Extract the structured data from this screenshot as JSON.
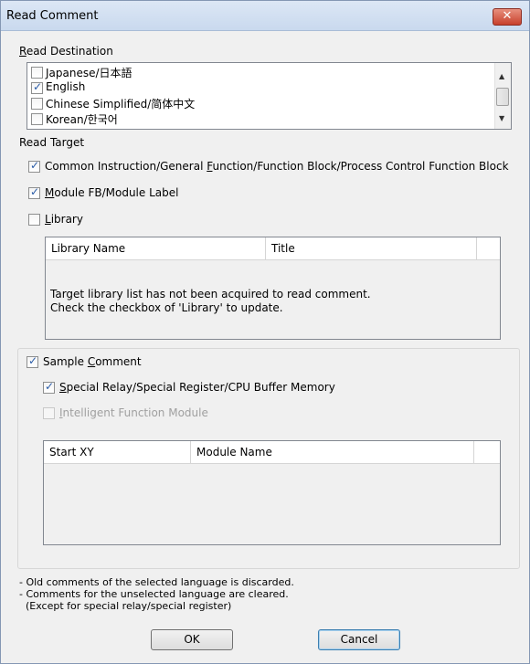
{
  "window": {
    "title": "Read Comment",
    "close_label": "✕"
  },
  "read_destination": {
    "label_u": "R",
    "label_rest": "ead Destination",
    "items": [
      {
        "label": "Japanese/日本語",
        "checked": false
      },
      {
        "label": "English",
        "checked": true
      },
      {
        "label": "Chinese  Simplified/简体中文",
        "checked": false
      },
      {
        "label": "Korean/한국어",
        "checked": false
      }
    ]
  },
  "read_target": {
    "label": "Read Target",
    "common_instruction": {
      "pre": "Common Instruction/General ",
      "u": "F",
      "post": "unction/Function Block/Process Control Function Block",
      "checked": true
    },
    "module_fb": {
      "u": "M",
      "post": "odule FB/Module Label",
      "checked": true
    },
    "library": {
      "u": "L",
      "post": "ibrary",
      "checked": false
    },
    "library_table": {
      "columns": [
        "Library Name",
        "Title"
      ],
      "message_line1": "Target library list has not been acquired to read comment.",
      "message_line2": "Check the checkbox of 'Library' to update."
    }
  },
  "sample_comment": {
    "pre": "Sample ",
    "u": "C",
    "post": "omment",
    "checked": true,
    "special_relay": {
      "u": "S",
      "post": "pecial Relay/Special Register/CPU Buffer Memory",
      "checked": true
    },
    "intelligent_module": {
      "u": "I",
      "post": "ntelligent Function Module",
      "checked": false,
      "disabled": true
    },
    "module_table": {
      "columns": [
        "Start XY",
        "Module Name"
      ]
    }
  },
  "notes": [
    "- Old comments of the selected language is discarded.",
    "- Comments for the unselected language are cleared.",
    "  (Except for special relay/special register)"
  ],
  "buttons": {
    "ok": "OK",
    "cancel": "Cancel"
  }
}
